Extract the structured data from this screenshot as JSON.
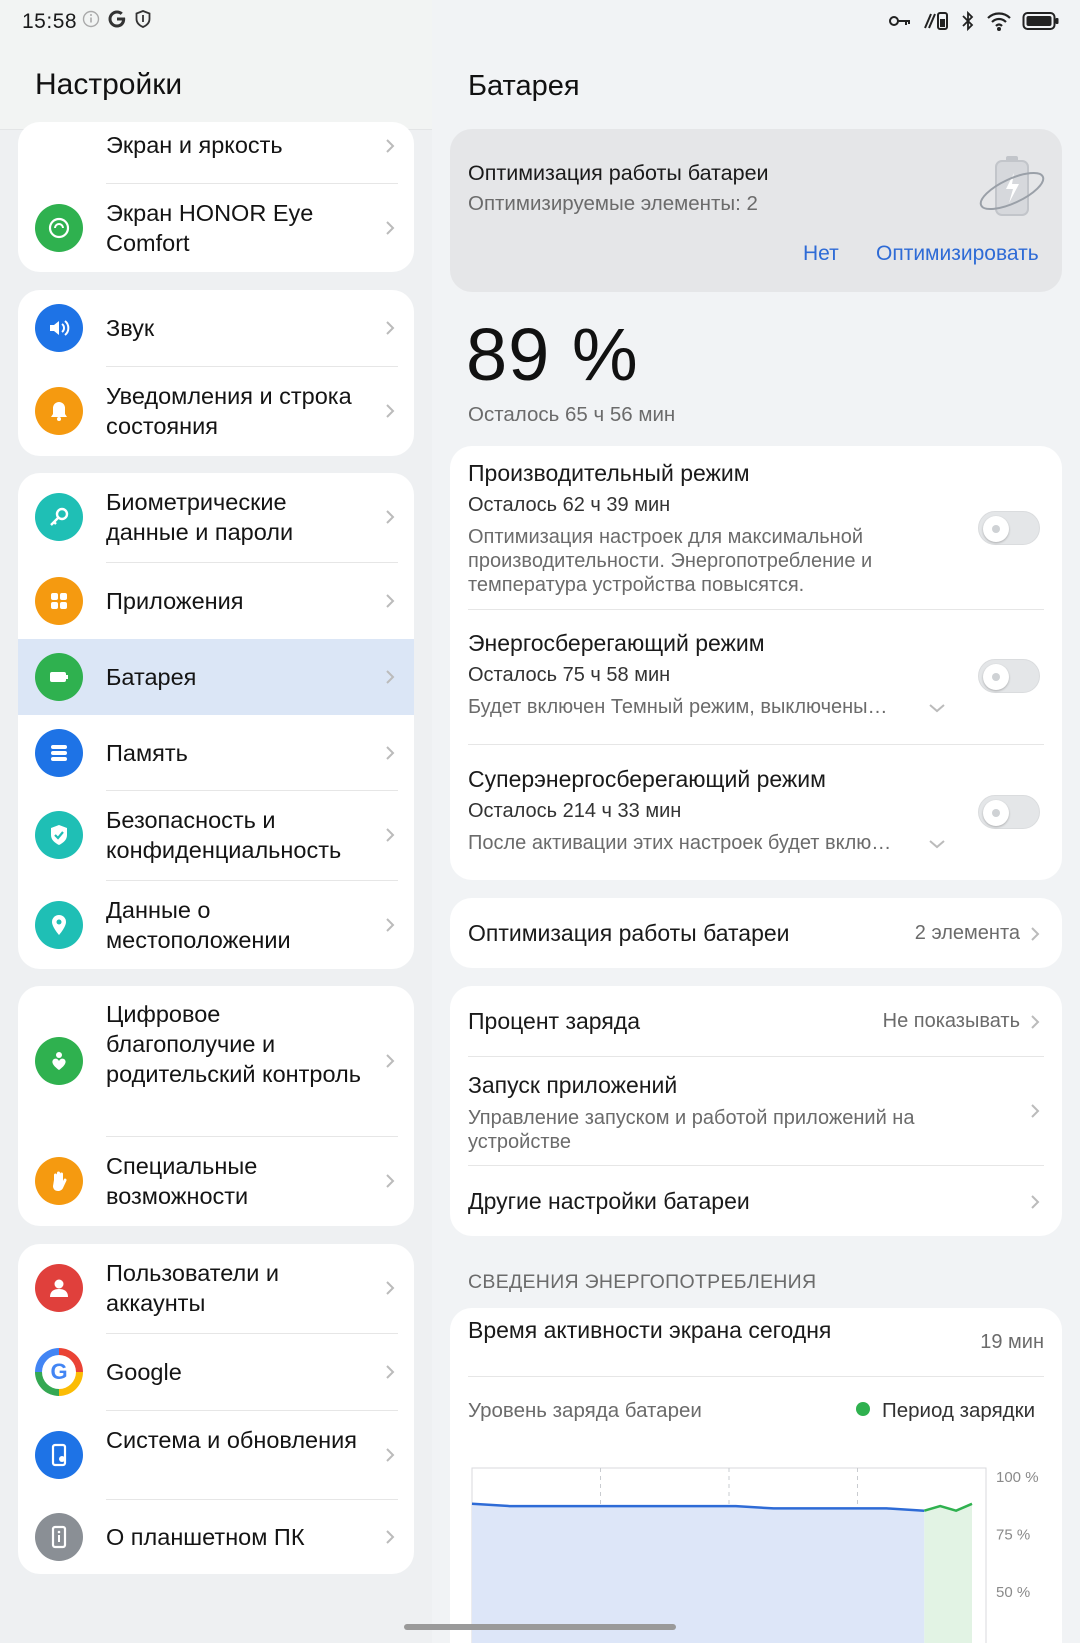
{
  "status_bar": {
    "time": "15:58"
  },
  "left": {
    "title": "Настройки",
    "items": [
      {
        "label": "Экран и яркость",
        "icon": "display-icon",
        "color": "#2fb14f"
      },
      {
        "label": "Экран HONOR Eye Comfort",
        "icon": "eye-comfort-icon",
        "color": "#2fb14f"
      },
      {
        "label": "Звук",
        "icon": "speaker-icon",
        "color": "#1e73e6"
      },
      {
        "label": "Уведомления и строка состояния",
        "icon": "bell-icon",
        "color": "#f59a10"
      },
      {
        "label": "Биометрические данные и пароли",
        "icon": "key-icon",
        "color": "#1fbfb5"
      },
      {
        "label": "Приложения",
        "icon": "apps-icon",
        "color": "#f59a10"
      },
      {
        "label": "Батарея",
        "icon": "battery-icon",
        "color": "#2fb14f"
      },
      {
        "label": "Память",
        "icon": "storage-icon",
        "color": "#1e73e6"
      },
      {
        "label": "Безопасность и конфиденциальность",
        "icon": "shield-icon",
        "color": "#1fbfb5"
      },
      {
        "label": "Данные о местоположении",
        "icon": "location-icon",
        "color": "#1fbfb5"
      },
      {
        "label": "Цифровое благополучие и родительский контроль",
        "icon": "wellbeing-icon",
        "color": "#2fb14f"
      },
      {
        "label": "Специальные возможности",
        "icon": "hand-icon",
        "color": "#f59a10"
      },
      {
        "label": "Пользователи и аккаунты",
        "icon": "user-icon",
        "color": "#e0403c"
      },
      {
        "label": "Google",
        "icon": "google-icon",
        "color": "#4285f4"
      },
      {
        "label": "Система и обновления",
        "icon": "system-update-icon",
        "color": "#1e73e6"
      },
      {
        "label": "О планшетном ПК",
        "icon": "info-icon",
        "color": "#8a8f95"
      }
    ]
  },
  "right": {
    "title": "Батарея",
    "optimize_card": {
      "title": "Оптимизация работы батареи",
      "subtitle": "Оптимизируемые элементы: 2",
      "no_label": "Нет",
      "optimize_label": "Оптимизировать"
    },
    "percent": "89 %",
    "remaining": "Осталось 65 ч 56 мин",
    "modes": [
      {
        "title": "Производительный режим",
        "remaining": "Осталось 62 ч 39 мин",
        "desc": "Оптимизация настроек для максимальной производительности. Энергопотребление и температура устройства повысятся.",
        "on": false
      },
      {
        "title": "Энергосберегающий режим",
        "remaining": "Осталось 75 ч 58 мин",
        "desc": "Будет включен Темный режим, выключены…",
        "on": false
      },
      {
        "title": "Суперэнергосберегающий режим",
        "remaining": "Осталось 214 ч 33 мин",
        "desc": "После активации этих настроек будет вклю…",
        "on": false
      }
    ],
    "battery_opt": {
      "label": "Оптимизация работы батареи",
      "value": "2 элемента"
    },
    "charge_percent": {
      "label": "Процент заряда",
      "value": "Не показывать"
    },
    "app_launch": {
      "label": "Запуск приложений",
      "desc": "Управление запуском и работой приложений на устройстве"
    },
    "other": {
      "label": "Другие настройки батареи"
    },
    "section_header": "СВЕДЕНИЯ ЭНЕРГОПОТРЕБЛЕНИЯ",
    "screen_time": {
      "label": "Время активности экрана сегодня",
      "value": "19 мин"
    },
    "chart_caption": "Уровень заряда батареи",
    "legend": "Период зарядки",
    "colors": {
      "accent": "#2e6bd6",
      "charging": "#2fb14f",
      "line": "#2e6bd6"
    }
  },
  "chart_data": {
    "type": "area",
    "title": "Уровень заряда батареи",
    "y_tick_labels": [
      "100 %",
      "75 %",
      "50 %"
    ],
    "ylim": [
      40,
      100
    ],
    "grid": true,
    "series": [
      {
        "name": "",
        "values": [
          94,
          93,
          93,
          93,
          93,
          93,
          93,
          93,
          92,
          92,
          92,
          92,
          91
        ]
      },
      {
        "name": "Период зарядки",
        "values": [
          91,
          93,
          91,
          94
        ]
      }
    ]
  }
}
